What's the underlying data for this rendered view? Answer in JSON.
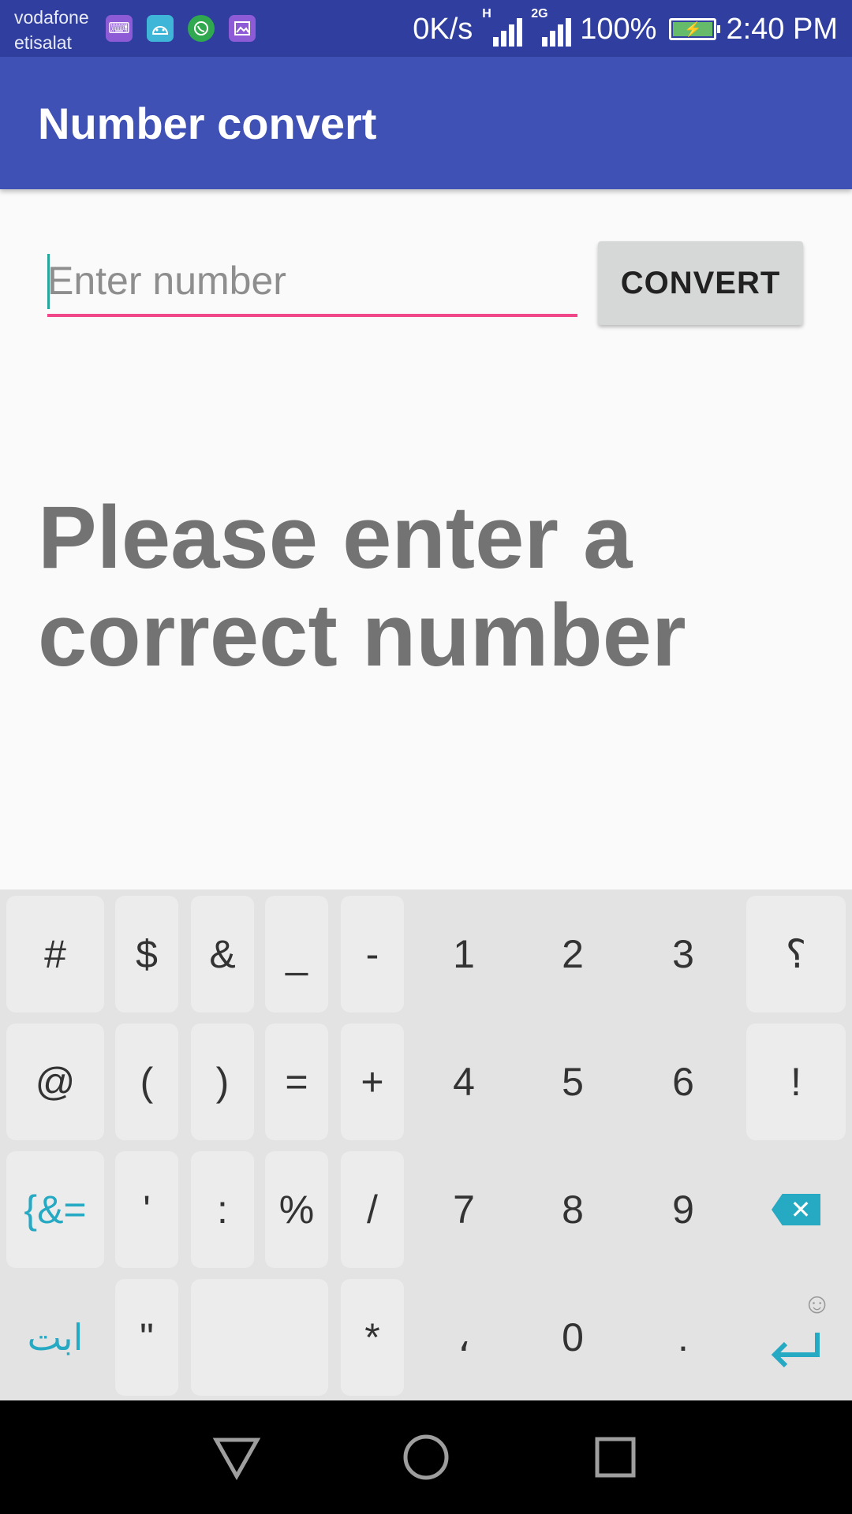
{
  "status_bar": {
    "carrier_line1": "vodafone",
    "carrier_line2": "etisalat",
    "net_speed": "0K/s",
    "signal1_tag": "H",
    "signal2_tag": "2G",
    "battery": "100%",
    "time": "2:40 PM",
    "notification_icons": [
      "keyboard-icon",
      "android-icon",
      "whatsapp-icon",
      "gallery-icon"
    ]
  },
  "app_bar": {
    "title": "Number convert"
  },
  "form": {
    "input_placeholder": "Enter number",
    "input_value": "",
    "convert_label": "CONVERT"
  },
  "result": {
    "message": "Please enter a correct number"
  },
  "keyboard": {
    "rows": [
      [
        "#",
        "$",
        "&",
        "_",
        "-",
        "1",
        "2",
        "3",
        "؟"
      ],
      [
        "@",
        "(",
        ")",
        "=",
        "+",
        "4",
        "5",
        "6",
        "!"
      ],
      [
        "{&=",
        "'",
        ":",
        "%",
        "/",
        "7",
        "8",
        "9",
        "backspace"
      ],
      [
        "ابت",
        "\"",
        "",
        "*",
        "،",
        "0",
        ".",
        "enter"
      ]
    ]
  },
  "colors": {
    "status_bar": "#303f9f",
    "app_bar": "#3f51b5",
    "accent": "#f0468a",
    "keyboard_accent": "#26a9c3",
    "message_text": "#737373"
  }
}
